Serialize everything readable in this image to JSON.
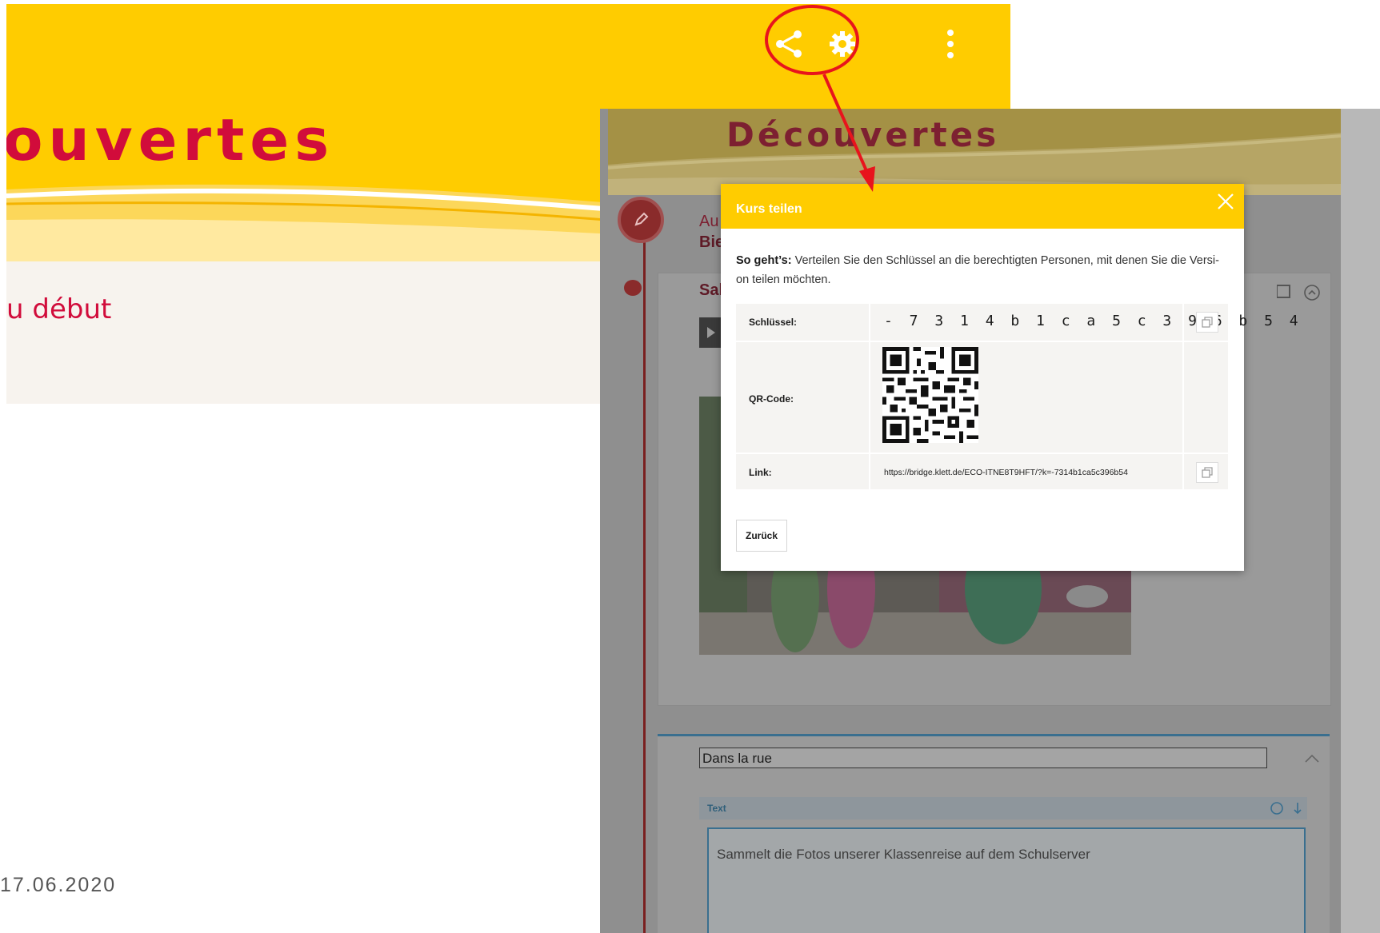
{
  "background_page": {
    "title": "ouvertes",
    "subtitle": "u début",
    "icons": [
      "share-icon",
      "gear-icon",
      "more-vertical-icon"
    ]
  },
  "footer": {
    "date": "17.06.2020"
  },
  "app": {
    "title": "Découvertes",
    "card1": {
      "heading_line1": "Au",
      "heading_line2": "Bie",
      "section_label": "Sal"
    },
    "card2": {
      "title_input_value": "Dans la rue",
      "block_type_label": "Text",
      "block_text": "Sammelt die Fotos unserer Klassenreise auf dem Schulserver"
    }
  },
  "modal": {
    "title": "Kurs teilen",
    "instruction_bold": "So geht’s:",
    "instruction_text": " Verteilen Sie den Schlüssel an die berechtigten Personen, mit denen Sie die Versi- on teilen möchten.",
    "key_label": "Schlüssel:",
    "key_value": "- 7 3 1 4 b 1 c a 5 c 3 9 6 b 5 4",
    "qr_label": "QR-Code:",
    "link_label": "Link:",
    "link_value": "https://bridge.klett.de/ECO-ITNE8T9HFT/?k=-7314b1ca5c396b54",
    "back_label": "Zurück"
  },
  "colors": {
    "accent_yellow": "#ffcc00",
    "title_red": "#d10c3b",
    "annotation_red": "#e8141c"
  }
}
